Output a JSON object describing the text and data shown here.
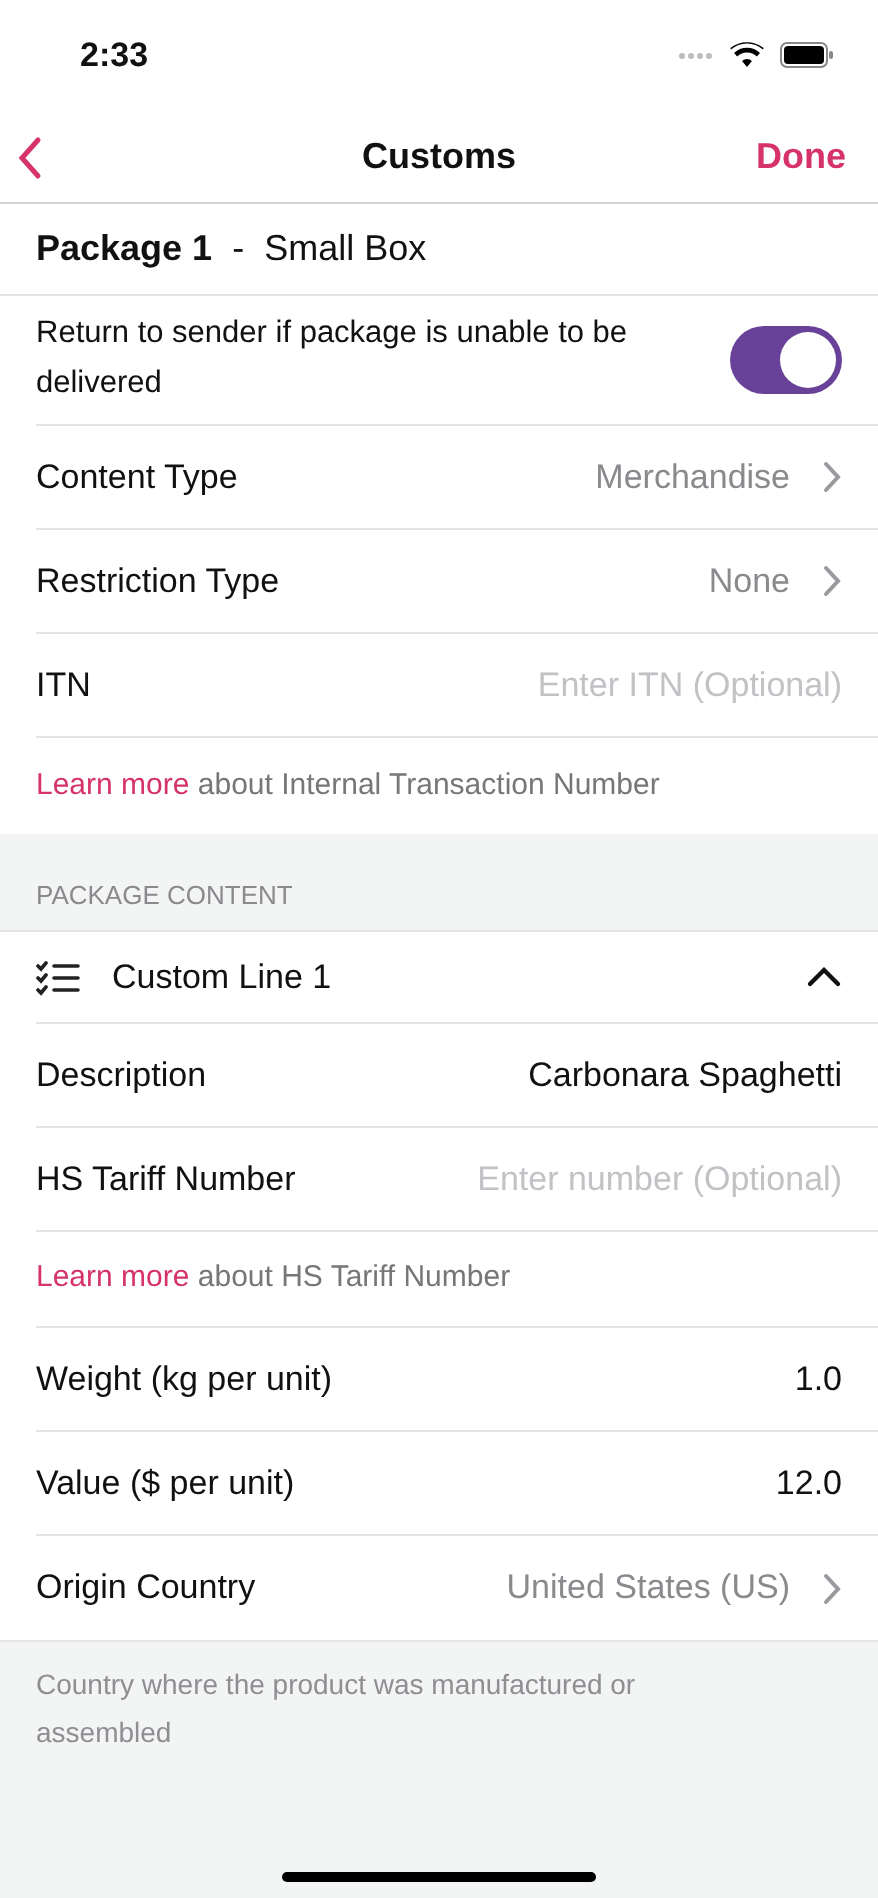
{
  "status_bar": {
    "time": "2:33"
  },
  "nav": {
    "title": "Customs",
    "done": "Done"
  },
  "package": {
    "title": "**Package 1**  -  Small Box"
  },
  "return_toggle": {
    "label": "Return to sender if package is unable to be delivered",
    "on": true
  },
  "rows": [
    {
      "kind": "select",
      "label": "Content Type",
      "value": "Merchandise"
    },
    {
      "kind": "select",
      "label": "Restriction Type",
      "value": "None"
    },
    {
      "kind": "input",
      "label": "ITN",
      "placeholder": "Enter ITN (Optional)"
    },
    {
      "kind": "link",
      "link": "Learn more",
      "text": "about Internal Transaction Number"
    }
  ],
  "section_header": "PACKAGE CONTENT",
  "custom_line": {
    "title": "Custom Line 1",
    "expanded": true,
    "rows": [
      {
        "kind": "input",
        "label": "Description",
        "value": "Carbonara Spaghetti"
      },
      {
        "kind": "input",
        "label": "HS Tariff Number",
        "placeholder": "Enter number (Optional)"
      },
      {
        "kind": "link",
        "link": "Learn more",
        "text": "about HS Tariff Number"
      },
      {
        "kind": "input",
        "label": "Weight (kg per unit)",
        "value": "1.0"
      },
      {
        "kind": "input",
        "label": "Value ($ per unit)",
        "value": "12.0"
      },
      {
        "kind": "select",
        "label": "Origin Country",
        "value": "United States (US)"
      }
    ]
  },
  "footnote": "Country where the product was manufactured or assembled"
}
